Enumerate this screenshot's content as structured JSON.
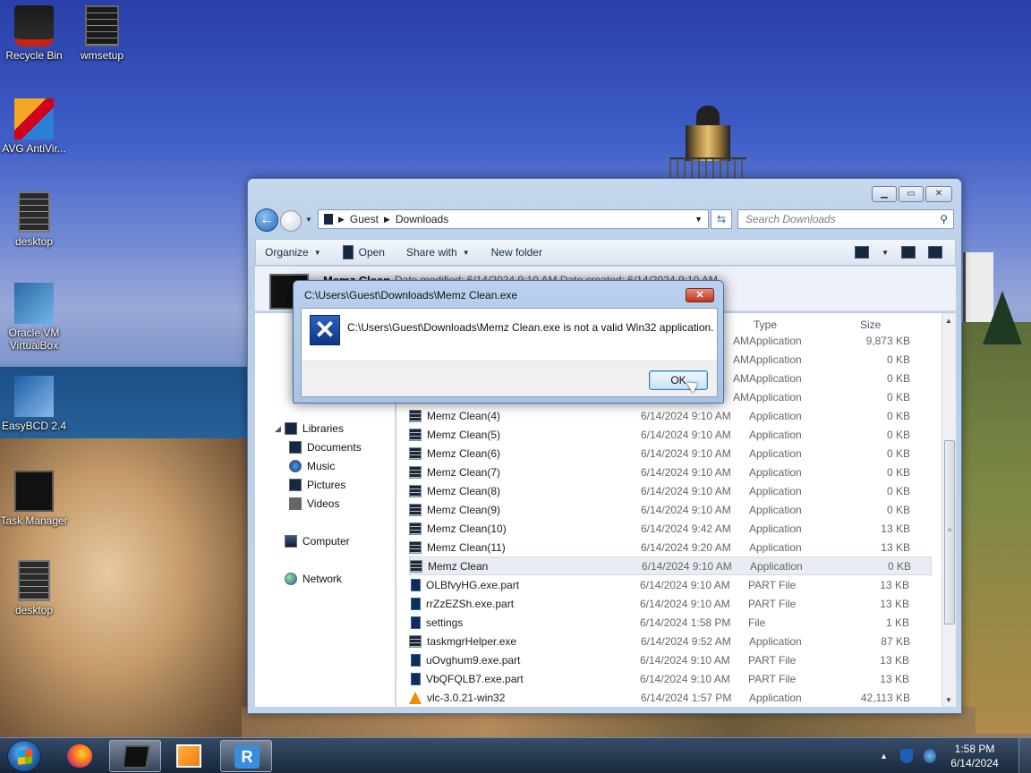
{
  "desktop": {
    "icons": [
      {
        "label": "Recycle Bin",
        "icon": "recycle-bin-icon"
      },
      {
        "label": "wmsetup",
        "icon": "document-icon"
      },
      {
        "label": "AVG AntiVir...",
        "icon": "avg-antivirus-icon"
      },
      {
        "label": "desktop",
        "icon": "document-icon"
      },
      {
        "label": "Oracle VM VirtualBox",
        "icon": "virtualbox-icon"
      },
      {
        "label": "EasyBCD 2.4",
        "icon": "easybcd-icon"
      },
      {
        "label": "Task Manager",
        "icon": "task-manager-icon"
      },
      {
        "label": "desktop",
        "icon": "document-icon"
      }
    ]
  },
  "explorer": {
    "address": {
      "segment1": "Guest",
      "segment2": "Downloads"
    },
    "search_placeholder": "Search Downloads",
    "toolbar": {
      "organize": "Organize",
      "open": "Open",
      "share_with": "Share with",
      "new_folder": "New folder"
    },
    "preview": {
      "name": "Memz Clean",
      "meta": "Date modified: 6/14/2024 9:10 AM      Date created: 6/14/2024 9:10 AM"
    },
    "nav": {
      "libraries": "Libraries",
      "documents": "Documents",
      "music": "Music",
      "pictures": "Pictures",
      "videos": "Videos",
      "computer": "Computer",
      "network": "Network"
    },
    "columns": {
      "type": "Type",
      "size": "Size"
    },
    "files": [
      {
        "name": "",
        "date": "AM",
        "type": "Application",
        "size": "9,873 KB",
        "icon": "app"
      },
      {
        "name": "",
        "date": "AM",
        "type": "Application",
        "size": "0 KB",
        "icon": "app"
      },
      {
        "name": "",
        "date": "AM",
        "type": "Application",
        "size": "0 KB",
        "icon": "app"
      },
      {
        "name": "",
        "date": "AM",
        "type": "Application",
        "size": "0 KB",
        "icon": "app"
      },
      {
        "name": "Memz Clean(4)",
        "date": "6/14/2024 9:10 AM",
        "type": "Application",
        "size": "0 KB",
        "icon": "app"
      },
      {
        "name": "Memz Clean(5)",
        "date": "6/14/2024 9:10 AM",
        "type": "Application",
        "size": "0 KB",
        "icon": "app"
      },
      {
        "name": "Memz Clean(6)",
        "date": "6/14/2024 9:10 AM",
        "type": "Application",
        "size": "0 KB",
        "icon": "app"
      },
      {
        "name": "Memz Clean(7)",
        "date": "6/14/2024 9:10 AM",
        "type": "Application",
        "size": "0 KB",
        "icon": "app"
      },
      {
        "name": "Memz Clean(8)",
        "date": "6/14/2024 9:10 AM",
        "type": "Application",
        "size": "0 KB",
        "icon": "app"
      },
      {
        "name": "Memz Clean(9)",
        "date": "6/14/2024 9:10 AM",
        "type": "Application",
        "size": "0 KB",
        "icon": "app"
      },
      {
        "name": "Memz Clean(10)",
        "date": "6/14/2024 9:42 AM",
        "type": "Application",
        "size": "13 KB",
        "icon": "app"
      },
      {
        "name": "Memz Clean(11)",
        "date": "6/14/2024 9:20 AM",
        "type": "Application",
        "size": "13 KB",
        "icon": "app"
      },
      {
        "name": "Memz Clean",
        "date": "6/14/2024 9:10 AM",
        "type": "Application",
        "size": "0 KB",
        "icon": "app",
        "selected": true
      },
      {
        "name": "OLBfvyHG.exe.part",
        "date": "6/14/2024 9:10 AM",
        "type": "PART File",
        "size": "13 KB",
        "icon": "part"
      },
      {
        "name": "rrZzEZSh.exe.part",
        "date": "6/14/2024 9:10 AM",
        "type": "PART File",
        "size": "13 KB",
        "icon": "part"
      },
      {
        "name": "settings",
        "date": "6/14/2024 1:58 PM",
        "type": "File",
        "size": "1 KB",
        "icon": "part"
      },
      {
        "name": "taskmgrHelper.exe",
        "date": "6/14/2024 9:52 AM",
        "type": "Application",
        "size": "87 KB",
        "icon": "app"
      },
      {
        "name": "uOvghum9.exe.part",
        "date": "6/14/2024 9:10 AM",
        "type": "PART File",
        "size": "13 KB",
        "icon": "part"
      },
      {
        "name": "VbQFQLB7.exe.part",
        "date": "6/14/2024 9:10 AM",
        "type": "PART File",
        "size": "13 KB",
        "icon": "part"
      },
      {
        "name": "vlc-3.0.21-win32",
        "date": "6/14/2024 1:57 PM",
        "type": "Application",
        "size": "42,113 KB",
        "icon": "vlc"
      }
    ]
  },
  "dialog": {
    "title": "C:\\Users\\Guest\\Downloads\\Memz Clean.exe",
    "message": "C:\\Users\\Guest\\Downloads\\Memz Clean.exe is not a valid Win32 application.",
    "ok": "OK",
    "close": "✕"
  },
  "taskbar": {
    "time": "1:58 PM",
    "date": "6/14/2024",
    "vnc_letter": "R"
  },
  "colors": {
    "selection": "#e9edf3",
    "dialog_border": "#4f6f9a",
    "close_red": "#c2331f"
  }
}
